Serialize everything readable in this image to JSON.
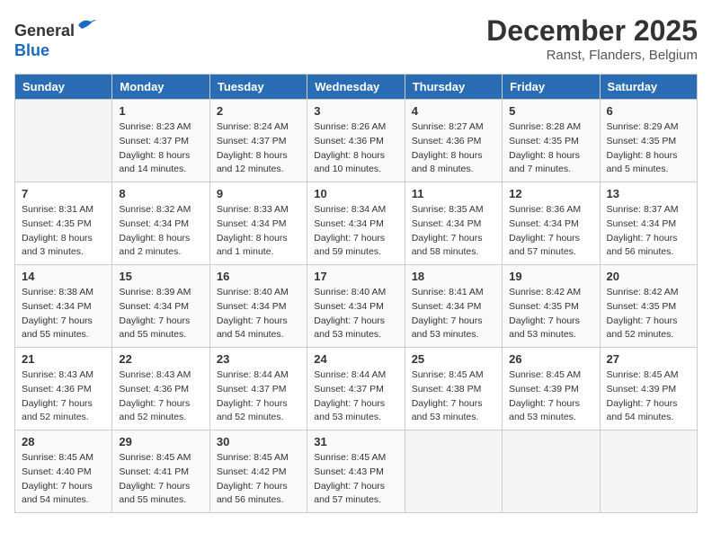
{
  "header": {
    "logo_line1": "General",
    "logo_line2": "Blue",
    "month_title": "December 2025",
    "location": "Ranst, Flanders, Belgium"
  },
  "days_of_week": [
    "Sunday",
    "Monday",
    "Tuesday",
    "Wednesday",
    "Thursday",
    "Friday",
    "Saturday"
  ],
  "weeks": [
    [
      {
        "day": "",
        "info": ""
      },
      {
        "day": "1",
        "info": "Sunrise: 8:23 AM\nSunset: 4:37 PM\nDaylight: 8 hours\nand 14 minutes."
      },
      {
        "day": "2",
        "info": "Sunrise: 8:24 AM\nSunset: 4:37 PM\nDaylight: 8 hours\nand 12 minutes."
      },
      {
        "day": "3",
        "info": "Sunrise: 8:26 AM\nSunset: 4:36 PM\nDaylight: 8 hours\nand 10 minutes."
      },
      {
        "day": "4",
        "info": "Sunrise: 8:27 AM\nSunset: 4:36 PM\nDaylight: 8 hours\nand 8 minutes."
      },
      {
        "day": "5",
        "info": "Sunrise: 8:28 AM\nSunset: 4:35 PM\nDaylight: 8 hours\nand 7 minutes."
      },
      {
        "day": "6",
        "info": "Sunrise: 8:29 AM\nSunset: 4:35 PM\nDaylight: 8 hours\nand 5 minutes."
      }
    ],
    [
      {
        "day": "7",
        "info": "Sunrise: 8:31 AM\nSunset: 4:35 PM\nDaylight: 8 hours\nand 3 minutes."
      },
      {
        "day": "8",
        "info": "Sunrise: 8:32 AM\nSunset: 4:34 PM\nDaylight: 8 hours\nand 2 minutes."
      },
      {
        "day": "9",
        "info": "Sunrise: 8:33 AM\nSunset: 4:34 PM\nDaylight: 8 hours\nand 1 minute."
      },
      {
        "day": "10",
        "info": "Sunrise: 8:34 AM\nSunset: 4:34 PM\nDaylight: 7 hours\nand 59 minutes."
      },
      {
        "day": "11",
        "info": "Sunrise: 8:35 AM\nSunset: 4:34 PM\nDaylight: 7 hours\nand 58 minutes."
      },
      {
        "day": "12",
        "info": "Sunrise: 8:36 AM\nSunset: 4:34 PM\nDaylight: 7 hours\nand 57 minutes."
      },
      {
        "day": "13",
        "info": "Sunrise: 8:37 AM\nSunset: 4:34 PM\nDaylight: 7 hours\nand 56 minutes."
      }
    ],
    [
      {
        "day": "14",
        "info": "Sunrise: 8:38 AM\nSunset: 4:34 PM\nDaylight: 7 hours\nand 55 minutes."
      },
      {
        "day": "15",
        "info": "Sunrise: 8:39 AM\nSunset: 4:34 PM\nDaylight: 7 hours\nand 55 minutes."
      },
      {
        "day": "16",
        "info": "Sunrise: 8:40 AM\nSunset: 4:34 PM\nDaylight: 7 hours\nand 54 minutes."
      },
      {
        "day": "17",
        "info": "Sunrise: 8:40 AM\nSunset: 4:34 PM\nDaylight: 7 hours\nand 53 minutes."
      },
      {
        "day": "18",
        "info": "Sunrise: 8:41 AM\nSunset: 4:34 PM\nDaylight: 7 hours\nand 53 minutes."
      },
      {
        "day": "19",
        "info": "Sunrise: 8:42 AM\nSunset: 4:35 PM\nDaylight: 7 hours\nand 53 minutes."
      },
      {
        "day": "20",
        "info": "Sunrise: 8:42 AM\nSunset: 4:35 PM\nDaylight: 7 hours\nand 52 minutes."
      }
    ],
    [
      {
        "day": "21",
        "info": "Sunrise: 8:43 AM\nSunset: 4:36 PM\nDaylight: 7 hours\nand 52 minutes."
      },
      {
        "day": "22",
        "info": "Sunrise: 8:43 AM\nSunset: 4:36 PM\nDaylight: 7 hours\nand 52 minutes."
      },
      {
        "day": "23",
        "info": "Sunrise: 8:44 AM\nSunset: 4:37 PM\nDaylight: 7 hours\nand 52 minutes."
      },
      {
        "day": "24",
        "info": "Sunrise: 8:44 AM\nSunset: 4:37 PM\nDaylight: 7 hours\nand 53 minutes."
      },
      {
        "day": "25",
        "info": "Sunrise: 8:45 AM\nSunset: 4:38 PM\nDaylight: 7 hours\nand 53 minutes."
      },
      {
        "day": "26",
        "info": "Sunrise: 8:45 AM\nSunset: 4:39 PM\nDaylight: 7 hours\nand 53 minutes."
      },
      {
        "day": "27",
        "info": "Sunrise: 8:45 AM\nSunset: 4:39 PM\nDaylight: 7 hours\nand 54 minutes."
      }
    ],
    [
      {
        "day": "28",
        "info": "Sunrise: 8:45 AM\nSunset: 4:40 PM\nDaylight: 7 hours\nand 54 minutes."
      },
      {
        "day": "29",
        "info": "Sunrise: 8:45 AM\nSunset: 4:41 PM\nDaylight: 7 hours\nand 55 minutes."
      },
      {
        "day": "30",
        "info": "Sunrise: 8:45 AM\nSunset: 4:42 PM\nDaylight: 7 hours\nand 56 minutes."
      },
      {
        "day": "31",
        "info": "Sunrise: 8:45 AM\nSunset: 4:43 PM\nDaylight: 7 hours\nand 57 minutes."
      },
      {
        "day": "",
        "info": ""
      },
      {
        "day": "",
        "info": ""
      },
      {
        "day": "",
        "info": ""
      }
    ]
  ]
}
